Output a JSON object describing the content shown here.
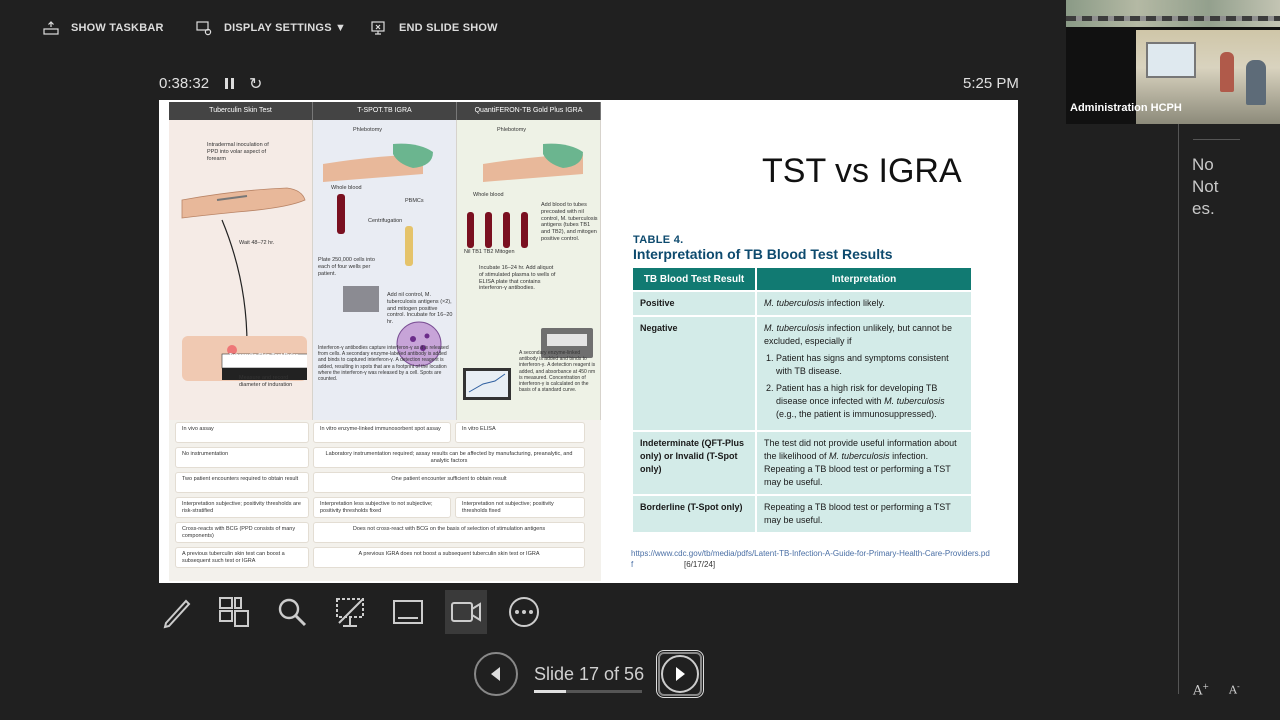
{
  "toolbar": {
    "show_taskbar": "SHOW TASKBAR",
    "display_settings": "DISPLAY SETTINGS ▼",
    "end_slide_show": "END SLIDE SHOW"
  },
  "timer": {
    "elapsed": "0:38:32",
    "clock": "5:25 PM"
  },
  "slide": {
    "title": "TST vs IGRA",
    "figure": {
      "headers": [
        "Tuberculin Skin Test",
        "T-SPOT.TB IGRA",
        "QuantiFERON-TB Gold Plus IGRA"
      ],
      "notes": {
        "tst1": "Intradermal inoculation of PPD into volar aspect of forearm",
        "tst2": "Wait 48–72 hr.",
        "tst3": "Tuberculin Skin Test Ruler",
        "tst4": "Measure and record diameter of induration",
        "ts1": "Phlebotomy",
        "ts2": "Whole blood",
        "ts3": "Centrifugation",
        "ts4": "PBMCs",
        "ts5": "Plate 250,000 cells into each of four wells per patient.",
        "ts6": "Add nil control, M. tuberculosis antigens (×2), and mitogen positive control. Incubate for 16–20 hr.",
        "ts7": "Interferon-γ antibodies capture interferon-γ as it is released from cells. A secondary enzyme-labeled antibody is added and binds to captured interferon-γ. A detection reagent is added, resulting in spots that are a footprint of the location where the interferon-γ was released by a cell. Spots are counted.",
        "qf1": "Phlebotomy",
        "qf2": "Whole blood",
        "qf3": "Add blood to tubes precoated with nil control, M. tuberculosis antigens (tubes TB1 and TB2), and mitogen positive control.",
        "qf4": "Nil   TB1   TB2  Mitogen",
        "qf5": "Incubate 16–24 hr. Add aliquot of stimulated plasma to wells of ELISA plate that contains interferon-γ antibodies.",
        "qf6": "A secondary enzyme-linked antibody is added and binds to interferon-γ. A detection reagent is added, and absorbance at 450 nm is measured. Concentration of interferon-γ is calculated on the basis of a standard curve."
      },
      "rows": [
        [
          "In vivo assay",
          "In vitro enzyme-linked immunosorbent spot assay",
          "In vitro ELISA"
        ],
        [
          "No instrumentation",
          "Laboratory instrumentation required; assay results can be affected by manufacturing, preanalytic, and analytic factors"
        ],
        [
          "Two patient encounters required to obtain result",
          "One patient encounter sufficient to obtain result"
        ],
        [
          "Interpretation subjective; positivity thresholds are risk-stratified",
          "Interpretation less subjective to not subjective; positivity thresholds fixed",
          "Interpretation not subjective; positivity thresholds fixed"
        ],
        [
          "Cross-reacts with BCG (PPD consists of many components)",
          "Does not cross-react with BCG on the basis of selection of stimulation antigens"
        ],
        [
          "A previous tuberculin skin test can boost a subsequent such test or IGRA",
          "A previous IGRA does not boost a subsequent tuberculin skin test or IGRA"
        ]
      ]
    },
    "table": {
      "label": "TABLE 4.",
      "title": "Interpretation of TB Blood Test Results",
      "col1": "TB Blood Test Result",
      "col2": "Interpretation",
      "positive_k": "Positive",
      "positive_em": "M. tuberculosis",
      "positive_v": " infection likely.",
      "negative_k": "Negative",
      "negative_em": "M. tuberculosis",
      "negative_v": " infection unlikely, but cannot be excluded, especially if",
      "negative_li1": "Patient has signs and symptoms consistent with TB disease.",
      "negative_li2a": "Patient has a high risk for developing TB disease once infected with ",
      "negative_li2em": "M. tuberculosis",
      "negative_li2b": " (e.g., the patient is immunosuppressed).",
      "indet_k": "Indeterminate (QFT-Plus only) or Invalid (T-Spot only)",
      "indet_va": "The test did not provide useful information about the likelihood of ",
      "indet_em": "M. tuberculosis",
      "indet_vb": " infection. Repeating a TB blood test or performing a TST may be useful.",
      "border_k": "Borderline (T-Spot only)",
      "border_v": "Repeating a TB blood test or performing a TST may be useful."
    },
    "source_link": "https://www.cdc.gov/tb/media/pdfs/Latent-TB-Infection-A-Guide-for-Primary-Health-Care-Providers.pdf",
    "source_date": " [6/17/24]"
  },
  "tools": [
    "pen-icon",
    "slides-grid-icon",
    "zoom-icon",
    "pointer-icon",
    "subtitles-icon",
    "camera-icon",
    "more-icon"
  ],
  "navigation": {
    "counter": "Slide 17 of 56",
    "progress": 0.3
  },
  "video": {
    "participant_name": "Administration HCPH"
  },
  "notes": {
    "text": "No Not es."
  }
}
